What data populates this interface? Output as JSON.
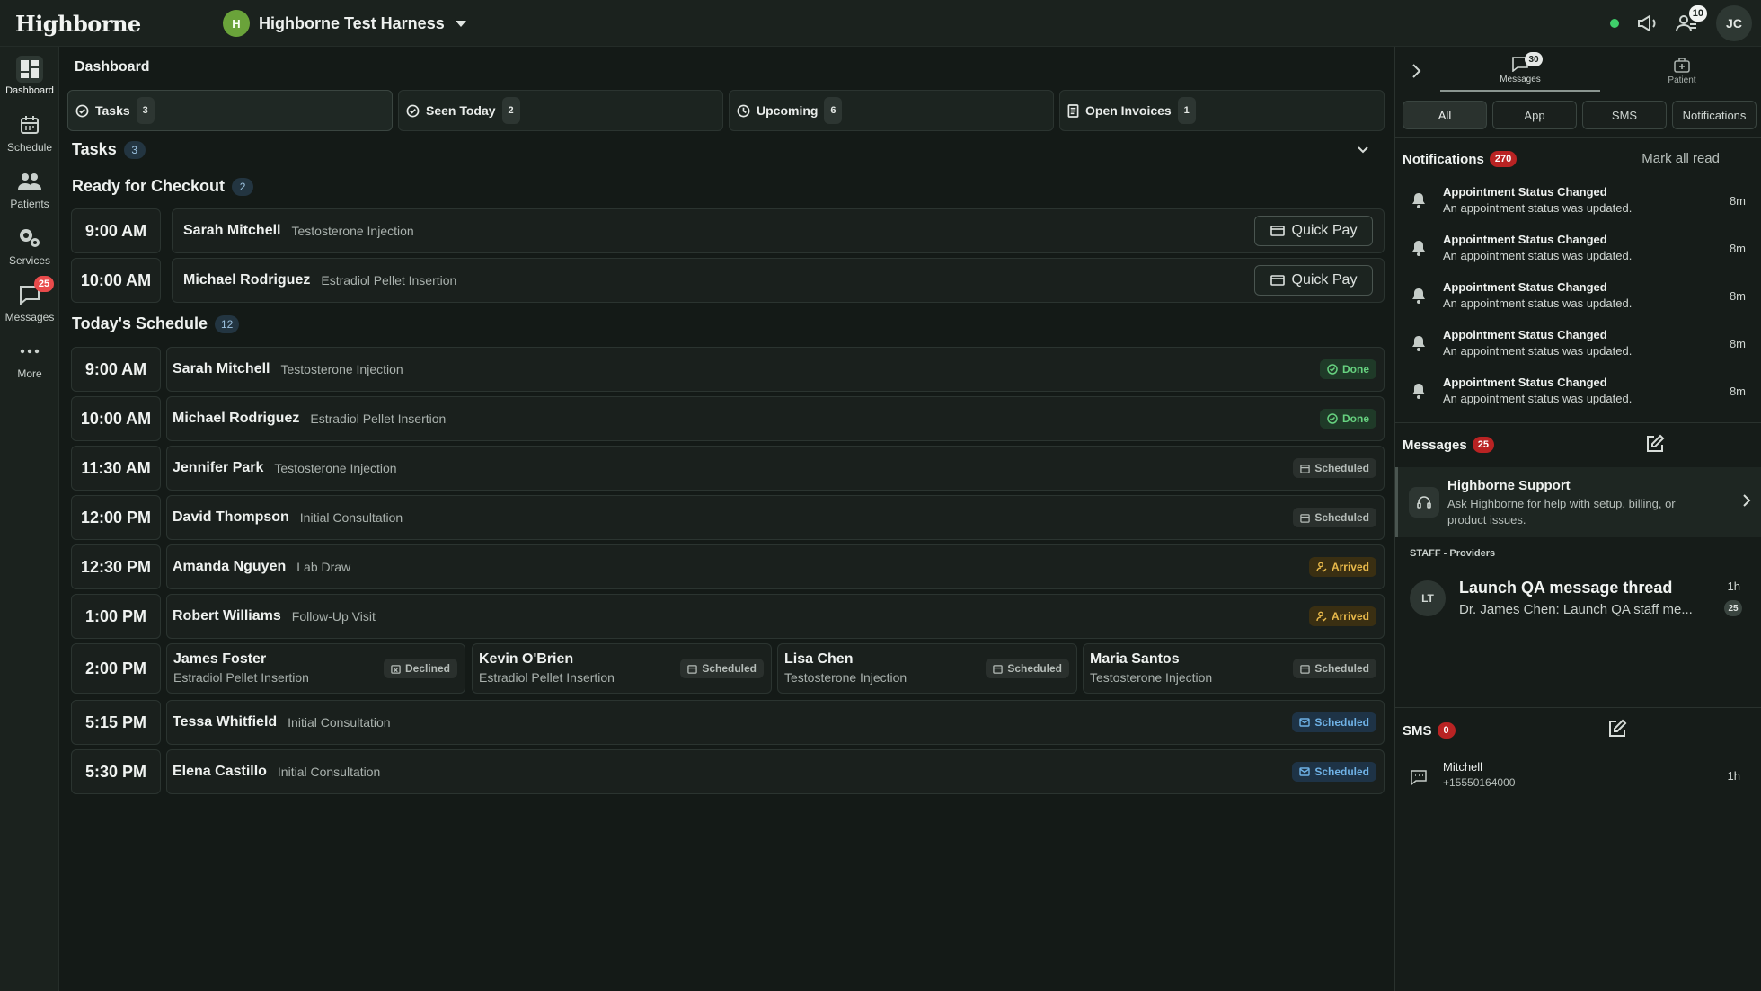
{
  "app": {
    "logo": "Highborne",
    "workspace": "Highborne Test Harness",
    "workspace_initial": "H",
    "user_initials": "JC",
    "team_badge": "10"
  },
  "nav": [
    {
      "label": "Dashboard",
      "icon": "dashboard-icon"
    },
    {
      "label": "Schedule",
      "icon": "calendar-icon"
    },
    {
      "label": "Patients",
      "icon": "users-icon"
    },
    {
      "label": "Services",
      "icon": "gears-icon"
    },
    {
      "label": "Messages",
      "icon": "chat-icon",
      "badge": "25"
    },
    {
      "label": "More",
      "icon": "ellipsis-icon"
    }
  ],
  "page": {
    "title": "Dashboard"
  },
  "stats": [
    {
      "label": "Tasks",
      "count": "3"
    },
    {
      "label": "Seen Today",
      "count": "2"
    },
    {
      "label": "Upcoming",
      "count": "6"
    },
    {
      "label": "Open Invoices",
      "count": "1"
    }
  ],
  "tasks": {
    "title": "Tasks",
    "count": "3"
  },
  "checkout": {
    "title": "Ready for Checkout",
    "count": "2",
    "button": "Quick Pay",
    "items": [
      {
        "time": "9:00 AM",
        "name": "Sarah Mitchell",
        "service": "Testosterone Injection"
      },
      {
        "time": "10:00 AM",
        "name": "Michael Rodriguez",
        "service": "Estradiol Pellet Insertion"
      }
    ]
  },
  "schedule": {
    "title": "Today's Schedule",
    "count": "12",
    "items": [
      {
        "time": "9:00 AM",
        "name": "Sarah Mitchell",
        "service": "Testosterone Injection",
        "status": "Done"
      },
      {
        "time": "10:00 AM",
        "name": "Michael Rodriguez",
        "service": "Estradiol Pellet Insertion",
        "status": "Done"
      },
      {
        "time": "11:30 AM",
        "name": "Jennifer Park",
        "service": "Testosterone Injection",
        "status": "Scheduled"
      },
      {
        "time": "12:00 PM",
        "name": "David Thompson",
        "service": "Initial Consultation",
        "status": "Scheduled"
      },
      {
        "time": "12:30 PM",
        "name": "Amanda Nguyen",
        "service": "Lab Draw",
        "status": "Arrived"
      },
      {
        "time": "1:00 PM",
        "name": "Robert Williams",
        "service": "Follow-Up Visit",
        "status": "Arrived"
      }
    ],
    "group": {
      "time": "2:00 PM",
      "items": [
        {
          "name": "James Foster",
          "service": "Estradiol Pellet Insertion",
          "status": "Declined"
        },
        {
          "name": "Kevin O'Brien",
          "service": "Estradiol Pellet Insertion",
          "status": "Scheduled"
        },
        {
          "name": "Lisa Chen",
          "service": "Testosterone Injection",
          "status": "Scheduled"
        },
        {
          "name": "Maria Santos",
          "service": "Testosterone Injection",
          "status": "Scheduled"
        }
      ]
    },
    "late": [
      {
        "time": "5:15 PM",
        "name": "Tessa Whitfield",
        "service": "Initial Consultation",
        "status": "Scheduled"
      },
      {
        "time": "5:30 PM",
        "name": "Elena Castillo",
        "service": "Initial Consultation",
        "status": "Scheduled"
      }
    ]
  },
  "panel": {
    "tabs": [
      {
        "label": "Messages",
        "badge": "30"
      },
      {
        "label": "Patient"
      }
    ],
    "filters": [
      "All",
      "App",
      "SMS",
      "Notifications"
    ],
    "notifications": {
      "title": "Notifications",
      "count": "270",
      "mark_all": "Mark all read",
      "items": [
        {
          "title": "Appointment Status Changed",
          "desc": "An appointment status was updated.",
          "time": "8m"
        },
        {
          "title": "Appointment Status Changed",
          "desc": "An appointment status was updated.",
          "time": "8m"
        },
        {
          "title": "Appointment Status Changed",
          "desc": "An appointment status was updated.",
          "time": "8m"
        },
        {
          "title": "Appointment Status Changed",
          "desc": "An appointment status was updated.",
          "time": "8m"
        },
        {
          "title": "Appointment Status Changed",
          "desc": "An appointment status was updated.",
          "time": "8m"
        }
      ]
    },
    "messages": {
      "title": "Messages",
      "count": "25",
      "support": {
        "title": "Highborne Support",
        "desc": "Ask Highborne for help with setup, billing, or product issues."
      },
      "group_label": "STAFF - Providers",
      "thread": {
        "initials": "LT",
        "title": "Launch QA message thread",
        "preview": "Dr. James Chen: Launch QA staff me...",
        "time": "1h",
        "count": "25"
      }
    },
    "sms": {
      "title": "SMS",
      "count": "0",
      "items": [
        {
          "name": "Mitchell",
          "phone": "+15550164000",
          "time": "1h"
        }
      ]
    }
  }
}
